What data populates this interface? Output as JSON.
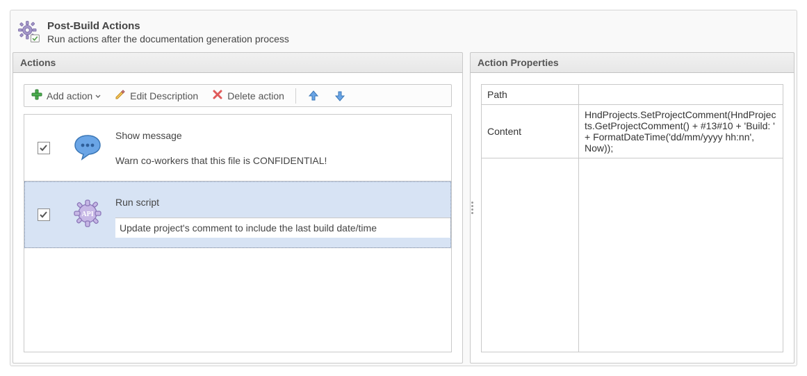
{
  "header": {
    "title": "Post-Build Actions",
    "subtitle": "Run actions after the documentation generation process"
  },
  "actions_section": {
    "title": "Actions",
    "toolbar": {
      "add_label": "Add action",
      "edit_label": "Edit Description",
      "delete_label": "Delete action"
    },
    "items": [
      {
        "checked": true,
        "selected": false,
        "title": "Show message",
        "description": "Warn co-workers that this file is CONFIDENTIAL!",
        "icon": "speech-bubble-icon"
      },
      {
        "checked": true,
        "selected": true,
        "title": "Run script",
        "description": "Update project's comment to include the last build date/time",
        "icon": "api-gear-icon"
      }
    ]
  },
  "properties_section": {
    "title": "Action Properties",
    "rows": [
      {
        "key": "Path",
        "value": ""
      },
      {
        "key": "Content",
        "value": "HndProjects.SetProjectComment(HndProjects.GetProjectComment() + #13#10 + 'Build: ' + FormatDateTime('dd/mm/yyyy hh:nn', Now));"
      }
    ]
  }
}
